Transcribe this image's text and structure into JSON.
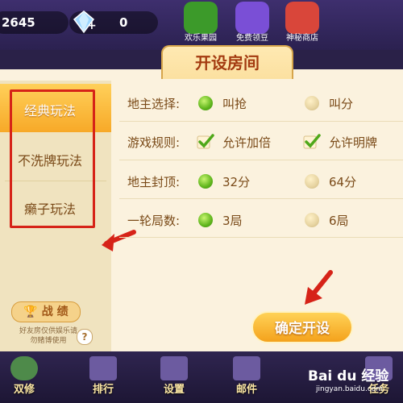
{
  "currency": {
    "coins": "2645",
    "gems": "0",
    "gem_plus": "+"
  },
  "top_nav": [
    {
      "label": "欢乐果园",
      "icon": "fruit-tree-icon",
      "color": "#3c9a2a"
    },
    {
      "label": "免费领豆",
      "icon": "video-play-icon",
      "color": "#7a4fd6"
    },
    {
      "label": "神秘商店",
      "icon": "shop-icon",
      "color": "#d9463a"
    }
  ],
  "dialog": {
    "title": "开设房间",
    "sidebar": {
      "items": [
        {
          "label": "经典玩法",
          "selected": true
        },
        {
          "label": "不洗牌玩法",
          "selected": false
        },
        {
          "label": "癞子玩法",
          "selected": false
        }
      ],
      "record_button": "战 绩",
      "note": "好友房仅供娱乐请勿赌博使用",
      "help": "?"
    },
    "rows": [
      {
        "label": "地主选择:",
        "type": "radio",
        "options": [
          {
            "label": "叫抢",
            "checked": true
          },
          {
            "label": "叫分",
            "checked": false
          }
        ]
      },
      {
        "label": "游戏规则:",
        "type": "check",
        "options": [
          {
            "label": "允许加倍",
            "checked": true
          },
          {
            "label": "允许明牌",
            "checked": true
          }
        ]
      },
      {
        "label": "地主封顶:",
        "type": "radio",
        "options": [
          {
            "label": "32分",
            "checked": true
          },
          {
            "label": "64分",
            "checked": false
          }
        ]
      },
      {
        "label": "一轮局数:",
        "type": "radio",
        "options": [
          {
            "label": "3局",
            "checked": true
          },
          {
            "label": "6局",
            "checked": false
          }
        ]
      }
    ],
    "confirm_button": "确定开设"
  },
  "bottom_nav": [
    {
      "label": "双修",
      "icon": "avatar-icon"
    },
    {
      "label": "排行",
      "icon": "bar-chart-icon"
    },
    {
      "label": "设置",
      "icon": "gear-icon"
    },
    {
      "label": "邮件",
      "icon": "mail-icon"
    },
    {
      "label": "任务",
      "icon": "task-icon"
    }
  ],
  "watermark": {
    "brand": "Bai du 经验",
    "url": "jingyan.baidu.com"
  },
  "colors": {
    "accent": "#f4a21c",
    "highlight": "#d62318",
    "title": "#a33a10"
  }
}
